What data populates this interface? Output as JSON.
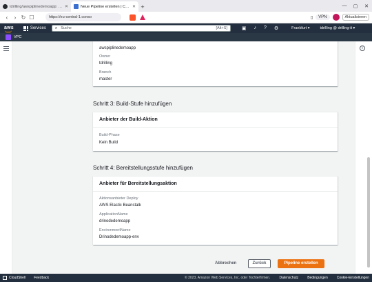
{
  "browser": {
    "tabs": [
      {
        "title": "tdrilling/awspiplinedemoapp: Imported",
        "active": false
      },
      {
        "title": "Neue Pipeline erstellen | CodePipeli",
        "active": true
      }
    ],
    "url": "https://eu-central-1.conso",
    "vpn_label": "VPN",
    "update_label": "Aktualisieren"
  },
  "aws": {
    "logo": "aws",
    "services_label": "Services",
    "search_placeholder": "Suche",
    "search_shortcut": "[Alt+S]",
    "region": "Frankfurt ▾",
    "user": "tdrilling @ drilling-it ▾",
    "service_badge": "VPC"
  },
  "source": {
    "repo_value": "awspiplinedemoapp",
    "owner_label": "Owner",
    "owner_value": "tdrilling",
    "branch_label": "Branch",
    "branch_value": "master"
  },
  "step3": {
    "heading": "Schritt 3: Build-Stufe hinzufügen",
    "card_title": "Anbieter der Build-Aktion",
    "phase_label": "Build-Phase",
    "phase_value": "Kein Build"
  },
  "step4": {
    "heading": "Schritt 4: Bereitstellungsstufe hinzufügen",
    "card_title": "Anbieter für Bereitstellungsaktion",
    "provider_label": "Aktionsanbieter Deploy",
    "provider_value": "AWS Elastic Beanstalk",
    "app_label": "ApplicationName",
    "app_value": "drinodedemoapp",
    "env_label": "EnvironmentName",
    "env_value": "Drinodedemoapp-env"
  },
  "actions": {
    "cancel": "Abbrechen",
    "back": "Zurück",
    "create": "Pipeline erstellen"
  },
  "footer": {
    "cloudshell": "CloudShell",
    "feedback": "Feedback",
    "copyright": "© 2023, Amazon Web Services, Inc. oder Tochterfirmen.",
    "privacy": "Datenschutz",
    "terms": "Bedingungen",
    "cookies": "Cookie-Einstellungen"
  },
  "colors": {
    "aws_nav": "#232f3e",
    "primary_button": "#ec7211",
    "vpc_icon": "#8c4fff"
  }
}
